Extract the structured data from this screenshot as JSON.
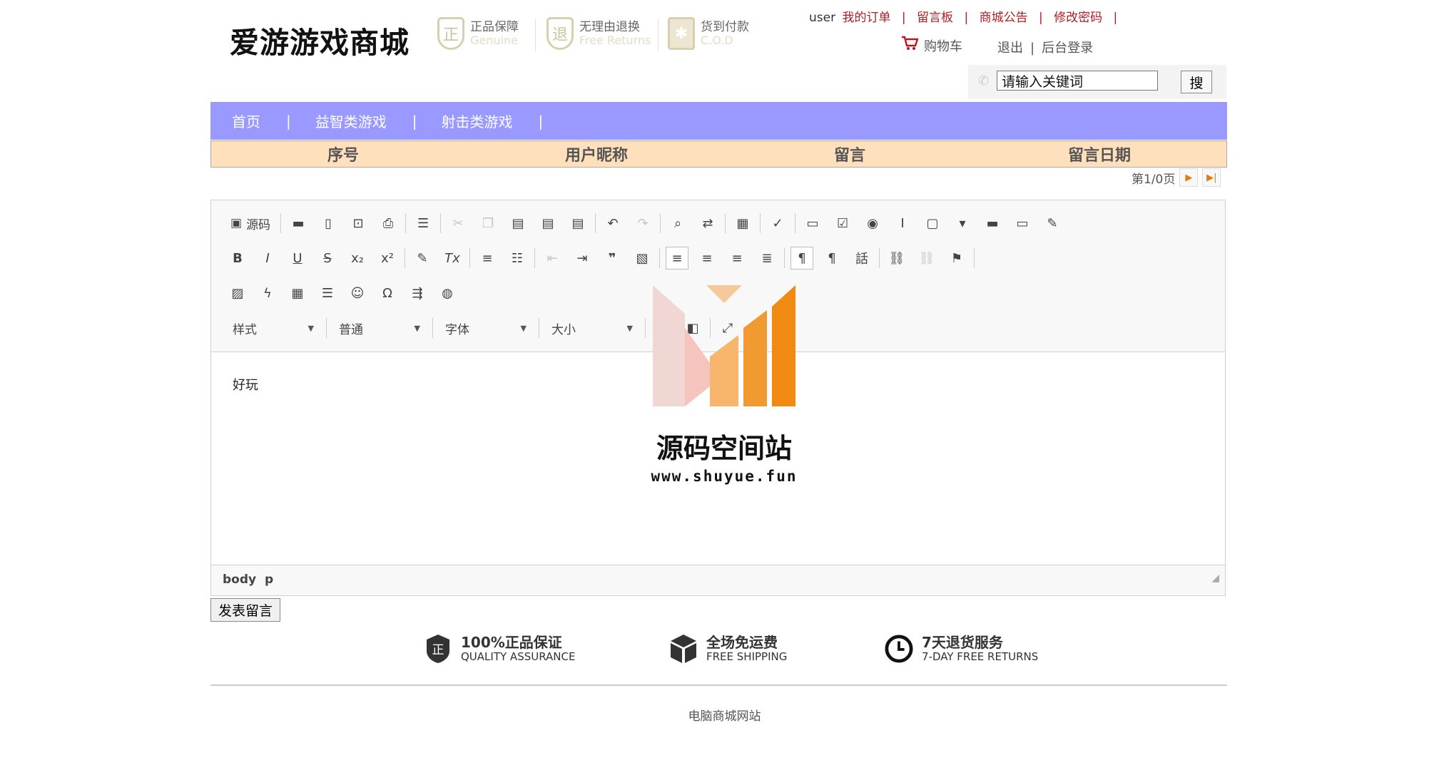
{
  "header": {
    "logo": "爱游游戏商城",
    "badges": [
      {
        "icon": "genuine-shield-icon",
        "glyph": "正",
        "title": "正品保障",
        "sub": "Genuine"
      },
      {
        "icon": "returns-shield-icon",
        "glyph": "退",
        "title": "无理由退换",
        "sub": "Free Returns"
      },
      {
        "icon": "gift-box-icon",
        "glyph": "✱",
        "title": "货到付款",
        "sub": "C.O.D"
      }
    ],
    "username": "user",
    "links": [
      "我的订单",
      "留言板",
      "商城公告",
      "修改密码"
    ],
    "link_separator": "|",
    "cart_label": "购物车",
    "logout_label": "退出",
    "admin_label": "后台登录",
    "search_value": "请输入关键词",
    "search_button": "搜"
  },
  "nav": {
    "items": [
      "首页",
      "益智类游戏",
      "射击类游戏"
    ],
    "separator": "|"
  },
  "table": {
    "columns": [
      "序号",
      "用户昵称",
      "留言",
      "留言日期"
    ]
  },
  "pager": {
    "text": "第1/0页",
    "next_icon": "next-page-icon",
    "last_icon": "last-page-icon"
  },
  "editor": {
    "source_label": "源码",
    "combos": [
      "样式",
      "普通",
      "字体",
      "大小"
    ],
    "content": "好玩",
    "path": [
      "body",
      "p"
    ]
  },
  "watermark": {
    "title": "源码空间站",
    "url": "www.shuyue.fun"
  },
  "post_button": "发表留言",
  "footer": {
    "items": [
      {
        "icon": "quality-shield-icon",
        "title": "100%正品保证",
        "sub": "QUALITY ASSURANCE"
      },
      {
        "icon": "package-box-icon",
        "title": "全场免运费",
        "sub": "FREE SHIPPING"
      },
      {
        "icon": "clock-icon",
        "title": "7天退货服务",
        "sub": "7-DAY FREE RETURNS"
      }
    ],
    "copyright": "电脑商城网站"
  },
  "colors": {
    "nav_bg": "#9999ff",
    "table_header_bg": "#ffe0bd",
    "link_red": "#b01e23",
    "watermark_orange": "#f39a2c"
  }
}
